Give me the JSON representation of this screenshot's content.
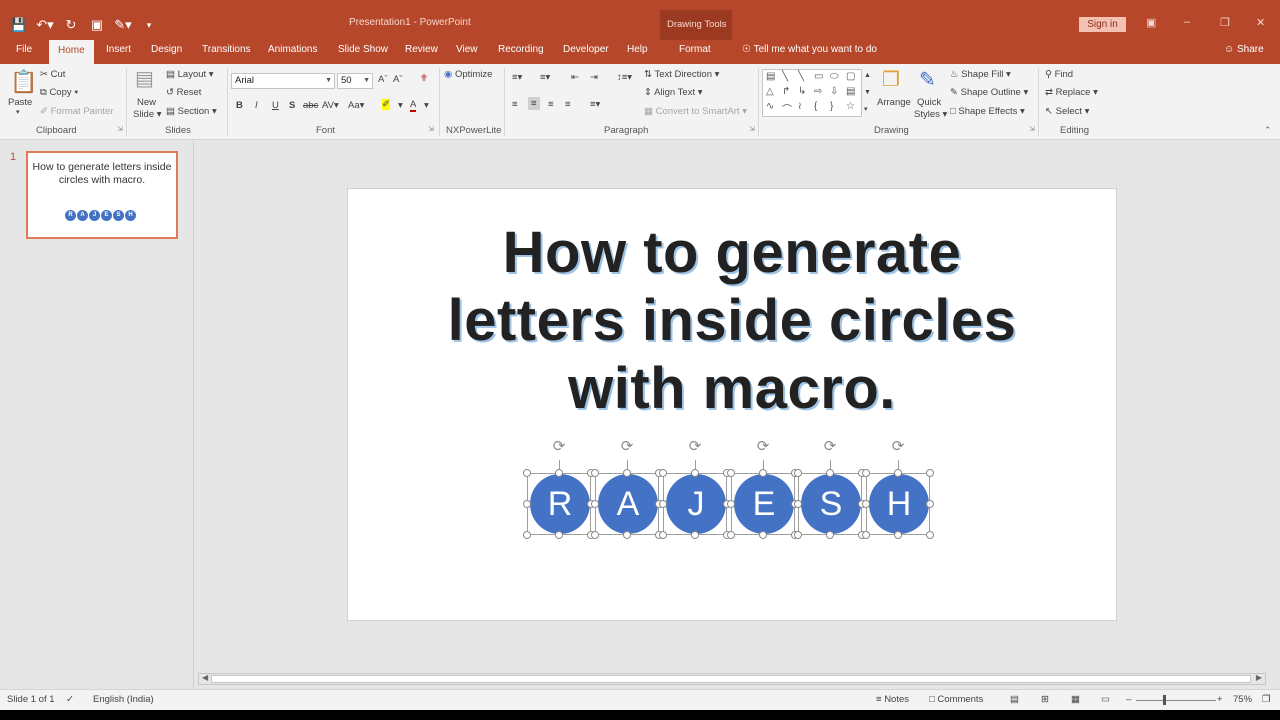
{
  "titlebar": {
    "doc_title": "Presentation1 - PowerPoint",
    "context_group": "Drawing Tools",
    "signin": "Sign in",
    "qat": [
      "save-icon",
      "undo-icon",
      "redo-icon",
      "present-icon",
      "pen-icon",
      "customize-icon"
    ]
  },
  "tabs": [
    "File",
    "Home",
    "Insert",
    "Design",
    "Transitions",
    "Animations",
    "Slide Show",
    "Review",
    "View",
    "Recording",
    "Developer",
    "Help",
    "Format"
  ],
  "tell_me": "Tell me what you want to do",
  "share": "Share",
  "ribbon": {
    "clipboard": {
      "paste": "Paste",
      "cut": "Cut",
      "copy": "Copy",
      "format_painter": "Format Painter",
      "label": "Clipboard"
    },
    "slides": {
      "new_slide": "New",
      "new_slide2": "Slide",
      "layout": "Layout",
      "reset": "Reset",
      "section": "Section",
      "label": "Slides"
    },
    "font": {
      "font_name": "Arial",
      "font_size": "50",
      "label": "Font"
    },
    "nxpowerlite": {
      "optimize": "Optimize",
      "label": "NXPowerLite"
    },
    "paragraph": {
      "text_direction": "Text Direction",
      "align_text": "Align Text",
      "convert_smartart": "Convert to SmartArt",
      "label": "Paragraph"
    },
    "drawing": {
      "arrange": "Arrange",
      "quick": "Quick",
      "styles": "Styles",
      "shape_fill": "Shape Fill",
      "shape_outline": "Shape Outline",
      "shape_effects": "Shape Effects",
      "label": "Drawing"
    },
    "editing": {
      "find": "Find",
      "replace": "Replace",
      "select": "Select",
      "label": "Editing"
    }
  },
  "thumbnail": {
    "number": "1",
    "title": "How to generate letters inside circles with macro."
  },
  "slide": {
    "title_line1": "How to generate",
    "title_line2": "letters inside circles",
    "title_line3": "with macro.",
    "letters": [
      "R",
      "A",
      "J",
      "E",
      "S",
      "H"
    ],
    "circle_color": "#4472c4"
  },
  "status": {
    "slide_info": "Slide 1 of 1",
    "language": "English (India)",
    "notes": "Notes",
    "comments": "Comments",
    "zoom": "75%"
  },
  "colors": {
    "accent": "#b7472a",
    "title_shadow": "#9dc3e6"
  }
}
